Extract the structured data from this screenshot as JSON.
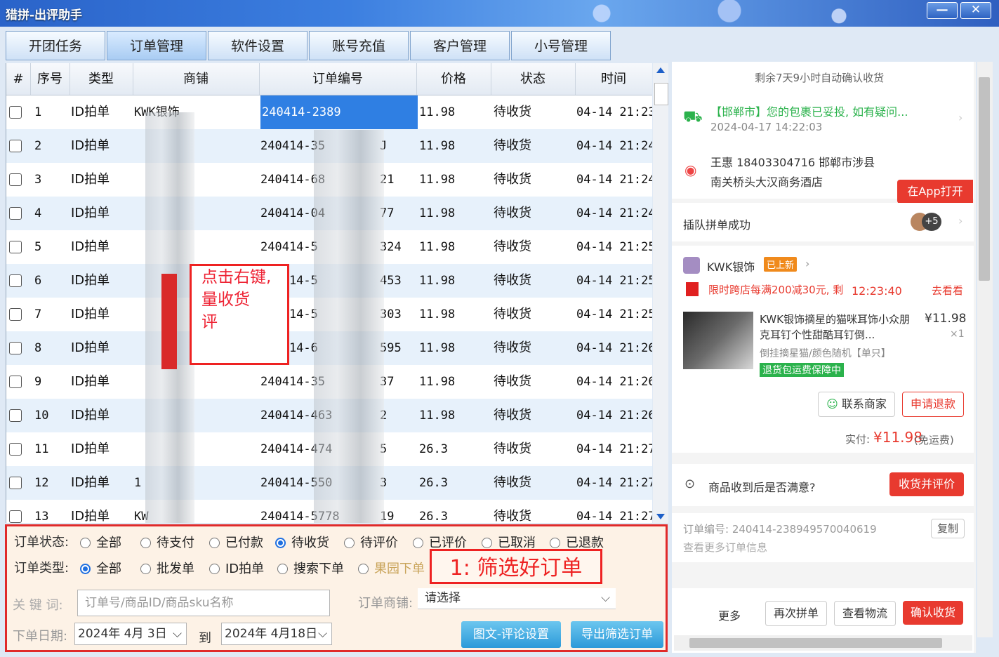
{
  "window": {
    "title": "猎拼-出评助手",
    "minimize": "—",
    "close": "✕"
  },
  "tabs": [
    "开团任务",
    "订单管理",
    "软件设置",
    "账号充值",
    "客户管理",
    "小号管理"
  ],
  "table": {
    "headers": [
      "#",
      "序号",
      "类型",
      "商铺",
      "订单编号",
      "价格",
      "状态",
      "时间"
    ],
    "rows": [
      {
        "no": "1",
        "type": "ID拍单",
        "shop": "KWK银饰",
        "order": "240414-2389",
        "price": "11.98",
        "status": "待收货",
        "time": "04-14 21:23"
      },
      {
        "no": "2",
        "type": "ID拍单",
        "shop": "",
        "order": "240414-35",
        "order_tail": "J",
        "price": "11.98",
        "status": "待收货",
        "time": "04-14 21:24"
      },
      {
        "no": "3",
        "type": "ID拍单",
        "shop": "",
        "order": "240414-68",
        "order_tail": "21",
        "price": "11.98",
        "status": "待收货",
        "time": "04-14 21:24"
      },
      {
        "no": "4",
        "type": "ID拍单",
        "shop": "",
        "order": "240414-04",
        "order_tail": "77",
        "price": "11.98",
        "status": "待收货",
        "time": "04-14 21:24"
      },
      {
        "no": "5",
        "type": "ID拍单",
        "shop": "",
        "order": "240414-5",
        "order_tail": "324",
        "price": "11.98",
        "status": "待收货",
        "time": "04-14 21:25"
      },
      {
        "no": "6",
        "type": "ID拍单",
        "shop": "",
        "order": "240414-5",
        "order_tail": "453",
        "price": "11.98",
        "status": "待收货",
        "time": "04-14 21:25"
      },
      {
        "no": "7",
        "type": "ID拍单",
        "shop": "",
        "order": "240414-5",
        "order_tail": "303",
        "price": "11.98",
        "status": "待收货",
        "time": "04-14 21:25"
      },
      {
        "no": "8",
        "type": "ID拍单",
        "shop": "",
        "order": "240414-6",
        "order_tail": "595",
        "price": "11.98",
        "status": "待收货",
        "time": "04-14 21:26"
      },
      {
        "no": "9",
        "type": "ID拍单",
        "shop": "",
        "order": "240414-35",
        "order_tail": "37",
        "price": "11.98",
        "status": "待收货",
        "time": "04-14 21:26"
      },
      {
        "no": "10",
        "type": "ID拍单",
        "shop": "",
        "order": "240414-463",
        "order_tail": "2",
        "price": "11.98",
        "status": "待收货",
        "time": "04-14 21:26"
      },
      {
        "no": "11",
        "type": "ID拍单",
        "shop": "",
        "order": "240414-474",
        "order_tail": "5",
        "price": "26.3",
        "status": "待收货",
        "time": "04-14 21:27"
      },
      {
        "no": "12",
        "type": "ID拍单",
        "shop": "1",
        "order": "240414-550",
        "order_tail": "3",
        "price": "26.3",
        "status": "待收货",
        "time": "04-14 21:27"
      },
      {
        "no": "13",
        "type": "ID拍单",
        "shop": "KW",
        "order": "240414-5778",
        "order_tail": "19",
        "price": "26.3",
        "status": "待收货",
        "time": "04-14 21:27"
      }
    ]
  },
  "annotation_right_click": [
    "点击右键,",
    "量收货",
    "评"
  ],
  "filter": {
    "status_label": "订单状态:",
    "status_options": [
      "全部",
      "待支付",
      "已付款",
      "待收货",
      "待评价",
      "已评价",
      "已取消",
      "已退款"
    ],
    "status_selected": "待收货",
    "type_label": "订单类型:",
    "type_options": [
      "全部",
      "批发单",
      "ID拍单",
      "搜索下单",
      "果园下单"
    ],
    "type_selected": "全部",
    "keyword_label": "关 键 词:",
    "keyword_placeholder": "订单号/商品ID/商品sku名称",
    "shop_label": "订单商铺:",
    "shop_value": "请选择",
    "date_label": "下单日期:",
    "date_from": "2024年 4月 3日",
    "date_to_label": "到",
    "date_to": "2024年 4月18日",
    "btn_comment_settings": "图文-评论设置",
    "btn_export": "导出筛选订单",
    "annotation": "1: 筛选好订单"
  },
  "detail": {
    "countdown": "剩余7天9小时自动确认收货",
    "logistics_text": "【邯郸市】您的包裹已妥投, 如有疑问...",
    "logistics_time": "2024-04-17 14:22:03",
    "address_name": "王惠 18403304716 邯郸市涉县",
    "address_line2": "南关桥头大汉商务酒店",
    "open_app": "在App打开",
    "group_success": "插队拼单成功",
    "avatar_more": "+5",
    "shop_name": "KWK银饰",
    "shop_badge": "已上新",
    "promo": "限时跨店每满200减30元, 剩",
    "promo_time": "12:23:40",
    "promo_link": "去看看",
    "product_title": "KWK银饰摘星的猫咪耳饰小众朋克耳钉个性甜酷耳钉倒...",
    "product_spec": "倒挂摘星猫/颜色随机【单只】",
    "product_price": "¥11.98",
    "product_qty": "×1",
    "product_tag": "退货包运费保障中",
    "btn_contact": "联系商家",
    "btn_refund": "申请退款",
    "paid_label": "实付:",
    "paid_value": "¥11.98",
    "paid_note": "(免运费)",
    "satisfaction": "商品收到后是否满意?",
    "btn_review": "收货并评价",
    "order_no": "订单编号: 240414-238949570040619",
    "btn_copy": "复制",
    "more_info": "查看更多订单信息",
    "btn_more": "更多",
    "btn_regroup": "再次拼单",
    "btn_logistics": "查看物流",
    "btn_confirm": "确认收货"
  }
}
